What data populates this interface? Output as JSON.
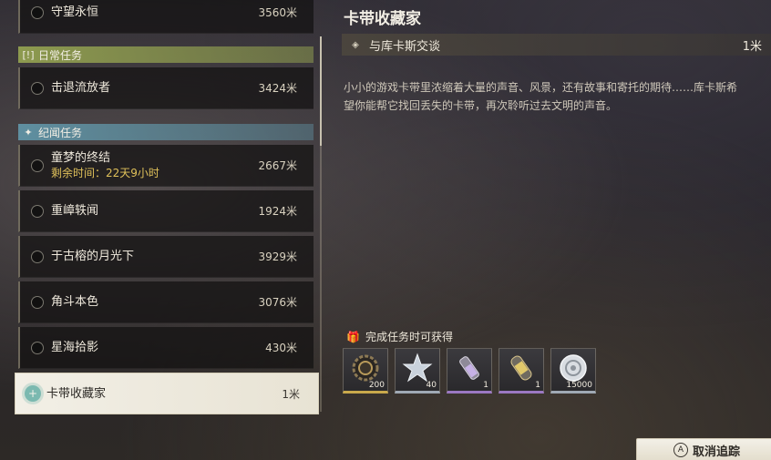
{
  "quest_list": {
    "top_item": {
      "name": "守望永恒",
      "distance": "3560米"
    },
    "daily_section": {
      "label": "日常任务"
    },
    "daily_items": [
      {
        "name": "击退流放者",
        "distance": "3424米"
      }
    ],
    "side_section": {
      "label": "纪闻任务"
    },
    "side_items": [
      {
        "name": "童梦的终结",
        "sub": "剩余时间：22天9小时",
        "distance": "2667米"
      },
      {
        "name": "重嶂轶闻",
        "distance": "1924米"
      },
      {
        "name": "于古榕的月光下",
        "distance": "3929米"
      },
      {
        "name": "角斗本色",
        "distance": "3076米"
      },
      {
        "name": "星海拾影",
        "distance": "430米"
      }
    ],
    "selected_item": {
      "name": "卡带收藏家",
      "distance": "1米"
    }
  },
  "detail": {
    "title": "卡带收藏家",
    "objective": {
      "text": "与库卡斯交谈",
      "distance": "1米"
    },
    "description_line1": "小小的游戏卡带里浓缩着大量的声音、风景，还有故事和寄托的期待……库卡斯希",
    "description_line2": "望你能帮它找回丢失的卡带，再次聆听过去文明的声音。",
    "rewards_label": "完成任务时可获得",
    "rewards": [
      {
        "icon": "gear-icon",
        "qty": "200",
        "rarity": "gold"
      },
      {
        "icon": "star-shard-icon",
        "qty": "40",
        "rarity": "silver"
      },
      {
        "icon": "vial-icon",
        "qty": "1",
        "rarity": "purple"
      },
      {
        "icon": "capsule-icon",
        "qty": "1",
        "rarity": "purple"
      },
      {
        "icon": "coin-icon",
        "qty": "15000",
        "rarity": "silver"
      }
    ]
  },
  "untrack_button": {
    "label": "取消追踪",
    "key_hint": "A"
  }
}
